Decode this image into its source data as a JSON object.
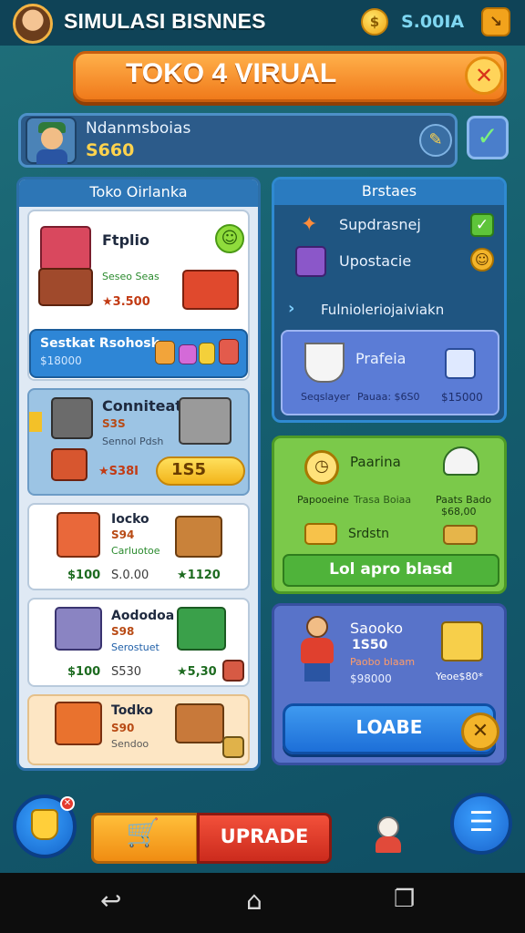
{
  "header": {
    "title": "SIMULASI BISNNES",
    "coins_value": "S.00IA",
    "coin_symbol": "$"
  },
  "banner": {
    "title": "TOKO 4 VIRUAL",
    "close_label": "✕"
  },
  "profile": {
    "name": "Ndanmsboias",
    "value": "S660"
  },
  "left_panel": {
    "title": "Toko Oirlanka",
    "items": [
      {
        "name": "Ftplio",
        "sub": "Seseo Seas",
        "star_price": "★3.500"
      },
      {
        "name": "Conniteat",
        "small": "S3S",
        "sub": "Sennol Pdsh",
        "star_price": "★S38I",
        "pill": "1S5"
      },
      {
        "name": "Iocko",
        "small": "S94",
        "sub": "Carluotoe",
        "price": "$100",
        "price2": "S.0.00",
        "star_price": "★1120"
      },
      {
        "name": "Aododoa",
        "small": "S98",
        "sub": "Serostuet",
        "price": "$100",
        "price2": "S530",
        "star_price": "★5,30"
      },
      {
        "name": "Todko",
        "small": "S90",
        "sub": "Sendoo"
      }
    ],
    "strip": {
      "label": "Sestkat Rsohosk",
      "price": "$18000"
    }
  },
  "status_panel": {
    "title": "Brstaes",
    "rows": [
      {
        "label": "Supdrasnej"
      },
      {
        "label": "Upostacie"
      }
    ],
    "expand_label": "Fulnioleriojaiviakn",
    "sub": {
      "title": "Prafeia",
      "meta1": "Seqslayer",
      "meta2": "Pauaa: $6S0",
      "price": "$15000"
    }
  },
  "green_panel": {
    "title": "Paarina",
    "meta_left": "Papooeine",
    "meta_mid": "Trasa Boiaa",
    "meta_right1": "Paats Bado",
    "meta_right2": "$68,00",
    "row_label": "Srdstn",
    "button_label": "Lol apro blasd"
  },
  "blue_panel": {
    "title": "Saooko",
    "value": "1S50",
    "sub": "Paobo blaam",
    "price": "$98000",
    "price_right": "Yeoe$80*",
    "button_label": "LOABE"
  },
  "bottom": {
    "upgrade_label": "UPRADE",
    "badge": "✕"
  },
  "colors": {
    "background": "#155e6e",
    "accent_orange": "#f07a1b",
    "accent_blue": "#2e86d6",
    "accent_green": "#7bc94a",
    "accent_red": "#cc2b1d"
  }
}
